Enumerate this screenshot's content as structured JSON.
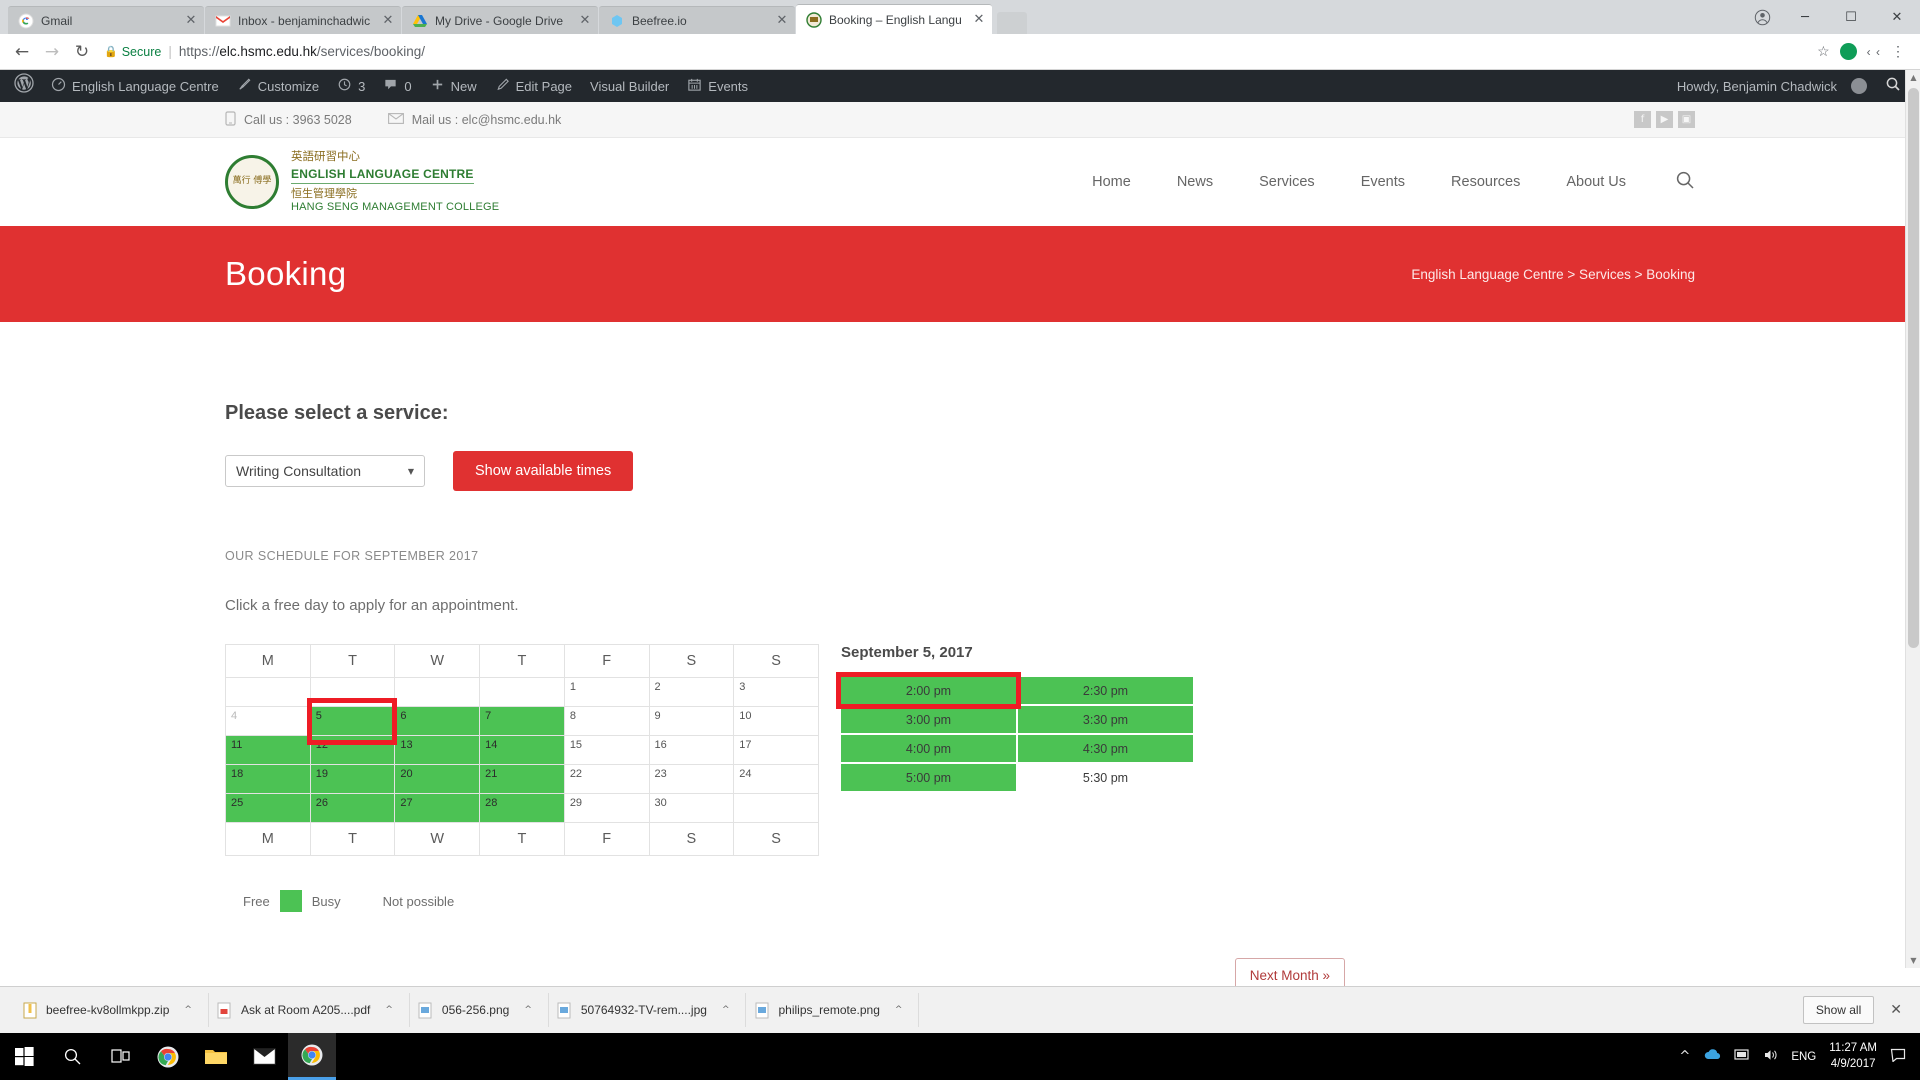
{
  "browser": {
    "tabs": [
      {
        "title": "Gmail",
        "favicon": "gmail-icon",
        "active": false
      },
      {
        "title": "Inbox - benjaminchadwic",
        "favicon": "gmail-m-icon",
        "active": false
      },
      {
        "title": "My Drive - Google Drive",
        "favicon": "drive-icon",
        "active": false
      },
      {
        "title": "Beefree.io",
        "favicon": "beefree-icon",
        "active": false
      },
      {
        "title": "Booking – English Langu",
        "favicon": "elc-icon",
        "active": true
      }
    ],
    "close_label": "✕",
    "nav": {
      "back": "←",
      "forward": "→",
      "reload": "↻"
    },
    "omnibox": {
      "secure_label": "Secure",
      "lock": "🔒",
      "separator": "|",
      "url_scheme": "https://",
      "url_host": "elc.hsmc.edu.hk",
      "url_path": "/services/booking/",
      "star": "☆",
      "ext_label": "‹ ‹",
      "menu": "⋮"
    },
    "window": {
      "profile": "○",
      "minimize": "─",
      "maximize": "☐",
      "close": "✕"
    }
  },
  "adminbar": {
    "wp_logo": "wordpress-icon",
    "items": [
      {
        "label": "English Language Centre",
        "icon": "dashboard-icon"
      },
      {
        "label": "Customize",
        "icon": "brush-icon"
      },
      {
        "label": "3",
        "icon": "updates-icon"
      },
      {
        "label": "0",
        "icon": "comment-icon"
      },
      {
        "label": "New",
        "icon": "plus-icon"
      },
      {
        "label": "Edit Page",
        "icon": "pencil-icon"
      },
      {
        "label": "Visual Builder",
        "icon": ""
      },
      {
        "label": "Events",
        "icon": "calendar-icon"
      }
    ],
    "howdy": "Howdy, Benjamin Chadwick",
    "search_icon": "search-icon"
  },
  "site": {
    "topbar": {
      "phone_label": "Call us : 3963 5028",
      "mail_label": "Mail us : elc@hsmc.edu.hk",
      "social": [
        {
          "name": "facebook-icon",
          "glyph": "f"
        },
        {
          "name": "youtube-icon",
          "glyph": "▶"
        },
        {
          "name": "instagram-icon",
          "glyph": "▣"
        }
      ]
    },
    "logo": {
      "seal_text": "萬行 傅學",
      "cn_line1": "英語研習中心",
      "en_line1": "ENGLISH LANGUAGE CENTRE",
      "cn_line2": "恒生管理學院",
      "en_line2": "HANG SENG MANAGEMENT COLLEGE"
    },
    "nav": [
      {
        "label": "Home"
      },
      {
        "label": "News"
      },
      {
        "label": "Services"
      },
      {
        "label": "Events"
      },
      {
        "label": "Resources"
      },
      {
        "label": "About Us"
      }
    ],
    "nav_search_icon": "search-icon",
    "banner": {
      "title": "Booking",
      "breadcrumb": "English Language Centre > Services > Booking"
    }
  },
  "main": {
    "heading": "Please select a service:",
    "service_select": {
      "value": "Writing Consultation",
      "caret": "▼",
      "options": [
        "Writing Consultation"
      ]
    },
    "show_times_button": "Show available times",
    "schedule_label": "OUR SCHEDULE FOR SEPTEMBER 2017",
    "click_note": "Click a free day to apply for an appointment.",
    "calendar": {
      "weekday_headers": [
        "M",
        "T",
        "W",
        "T",
        "F",
        "S",
        "S"
      ],
      "weeks": [
        [
          {
            "day": "",
            "state": "empty"
          },
          {
            "day": "",
            "state": "empty"
          },
          {
            "day": "",
            "state": "empty"
          },
          {
            "day": "",
            "state": "empty"
          },
          {
            "day": "1",
            "state": "free"
          },
          {
            "day": "2",
            "state": "free"
          },
          {
            "day": "3",
            "state": "free"
          }
        ],
        [
          {
            "day": "4",
            "state": "dim"
          },
          {
            "day": "5",
            "state": "busy",
            "selected": true
          },
          {
            "day": "6",
            "state": "busy"
          },
          {
            "day": "7",
            "state": "busy"
          },
          {
            "day": "8",
            "state": "free"
          },
          {
            "day": "9",
            "state": "free"
          },
          {
            "day": "10",
            "state": "free"
          }
        ],
        [
          {
            "day": "11",
            "state": "busy"
          },
          {
            "day": "12",
            "state": "busy"
          },
          {
            "day": "13",
            "state": "busy"
          },
          {
            "day": "14",
            "state": "busy"
          },
          {
            "day": "15",
            "state": "free"
          },
          {
            "day": "16",
            "state": "free"
          },
          {
            "day": "17",
            "state": "free"
          }
        ],
        [
          {
            "day": "18",
            "state": "busy"
          },
          {
            "day": "19",
            "state": "busy"
          },
          {
            "day": "20",
            "state": "busy"
          },
          {
            "day": "21",
            "state": "busy"
          },
          {
            "day": "22",
            "state": "free"
          },
          {
            "day": "23",
            "state": "free"
          },
          {
            "day": "24",
            "state": "free"
          }
        ],
        [
          {
            "day": "25",
            "state": "busy"
          },
          {
            "day": "26",
            "state": "busy"
          },
          {
            "day": "27",
            "state": "busy"
          },
          {
            "day": "28",
            "state": "busy"
          },
          {
            "day": "29",
            "state": "free"
          },
          {
            "day": "30",
            "state": "free"
          },
          {
            "day": "",
            "state": "empty"
          }
        ]
      ],
      "footer_headers": [
        "M",
        "T",
        "W",
        "T",
        "F",
        "S",
        "S"
      ]
    },
    "slots": {
      "date_label": "September 5, 2017",
      "items": [
        {
          "time": "2:00 pm",
          "state": "available",
          "selected": true
        },
        {
          "time": "2:30 pm",
          "state": "available"
        },
        {
          "time": "3:00 pm",
          "state": "available"
        },
        {
          "time": "3:30 pm",
          "state": "available"
        },
        {
          "time": "4:00 pm",
          "state": "available"
        },
        {
          "time": "4:30 pm",
          "state": "available"
        },
        {
          "time": "5:00 pm",
          "state": "available"
        },
        {
          "time": "5:30 pm",
          "state": "taken"
        }
      ]
    },
    "legend": {
      "free_label": "Free",
      "busy_label": "Busy",
      "not_possible_label": "Not possible",
      "busy_color": "#4cc254"
    },
    "next_month_button": "Next Month »"
  },
  "downloads": {
    "items": [
      {
        "name": "beefree-kv8ollmkpp.zip",
        "icon": "zip-file-icon",
        "caret": "^"
      },
      {
        "name": "Ask at Room A205....pdf",
        "icon": "pdf-file-icon",
        "caret": "^"
      },
      {
        "name": "056-256.png",
        "icon": "image-file-icon",
        "caret": "^"
      },
      {
        "name": "50764932-TV-rem....jpg",
        "icon": "image-file-icon",
        "caret": "^"
      },
      {
        "name": "philips_remote.png",
        "icon": "image-file-icon",
        "caret": "^"
      }
    ],
    "show_all": "Show all",
    "close": "✕"
  },
  "taskbar": {
    "start_icon": "windows-icon",
    "search_icon": "search-icon",
    "taskview_icon": "task-view-icon",
    "apps": [
      {
        "name": "chrome-icon"
      },
      {
        "name": "file-explorer-icon"
      },
      {
        "name": "mail-icon"
      },
      {
        "name": "chrome-active-icon"
      }
    ],
    "tray": {
      "chevron": "^",
      "onedrive_icon": "onedrive-icon",
      "network_icon": "network-icon",
      "volume_icon": "volume-icon",
      "language": "ENG",
      "time": "11:27 AM",
      "date": "4/9/2017",
      "action_center": "action-center-icon"
    }
  },
  "colors": {
    "brand_red": "#e03131",
    "busy_green": "#4cc254",
    "selection_red": "#ee1c25",
    "admin_dark": "#23282d"
  }
}
